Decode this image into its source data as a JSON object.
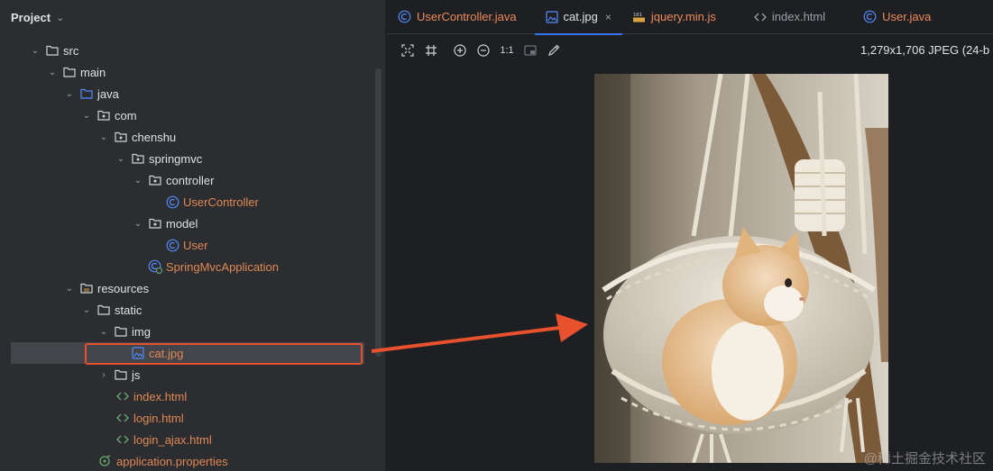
{
  "project_panel": {
    "title": "Project",
    "tree": [
      {
        "label": "src",
        "icon": "folder-icon",
        "expanded": true
      },
      {
        "label": "main",
        "icon": "folder-icon",
        "expanded": true
      },
      {
        "label": "java",
        "icon": "source-folder-icon",
        "expanded": true
      },
      {
        "label": "com",
        "icon": "package-icon",
        "expanded": true
      },
      {
        "label": "chenshu",
        "icon": "package-icon",
        "expanded": true
      },
      {
        "label": "springmvc",
        "icon": "package-icon",
        "expanded": true
      },
      {
        "label": "controller",
        "icon": "package-icon",
        "expanded": true
      },
      {
        "label": "UserController",
        "icon": "class-icon"
      },
      {
        "label": "model",
        "icon": "package-icon",
        "expanded": true
      },
      {
        "label": "User",
        "icon": "class-icon"
      },
      {
        "label": "SpringMvcApplication",
        "icon": "spring-class-icon"
      },
      {
        "label": "resources",
        "icon": "resources-folder-icon",
        "expanded": true
      },
      {
        "label": "static",
        "icon": "folder-icon",
        "expanded": true
      },
      {
        "label": "img",
        "icon": "folder-icon",
        "expanded": true
      },
      {
        "label": "cat.jpg",
        "icon": "image-file-icon",
        "selected": true
      },
      {
        "label": "js",
        "icon": "folder-icon",
        "expanded": false
      },
      {
        "label": "index.html",
        "icon": "html-file-icon"
      },
      {
        "label": "login.html",
        "icon": "html-file-icon"
      },
      {
        "label": "login_ajax.html",
        "icon": "html-file-icon"
      },
      {
        "label": "application.properties",
        "icon": "properties-file-icon"
      }
    ]
  },
  "editor": {
    "tabs": [
      {
        "label": "UserController.java",
        "icon": "class-icon"
      },
      {
        "label": "cat.jpg",
        "icon": "image-file-icon",
        "active": true
      },
      {
        "label": "jquery.min.js",
        "icon": "js-file-icon"
      },
      {
        "label": "index.html",
        "icon": "html-file-icon"
      },
      {
        "label": "User.java",
        "icon": "class-icon"
      }
    ],
    "toolbar": {
      "zoom_actual_label": "1:1"
    },
    "image_info": "1,279x1,706 JPEG (24-b"
  },
  "watermark": "@稀土掘金技术社区",
  "colors": {
    "panel_bg": "#2b2d30",
    "editor_bg": "#1e1f22",
    "file_label_orange": "#e08855",
    "selection_bg": "#43454a",
    "annotation_red": "#e8512d",
    "tab_underline": "#3574f0"
  }
}
